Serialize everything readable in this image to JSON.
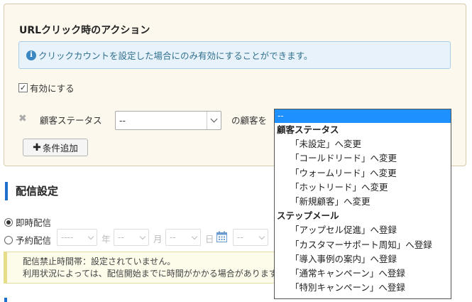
{
  "url_action": {
    "title": "URLクリック時のアクション",
    "info": "クリックカウントを設定した場合にのみ有効にすることができます。",
    "enable_label": "有効にする",
    "enable_checked": true,
    "condition": {
      "remove_symbol": "✖",
      "label": "顧客ステータス",
      "select_value": "--",
      "suffix": "の顧客を"
    },
    "add_button_label": "条件追加"
  },
  "dropdown": {
    "selected": "--",
    "groups": [
      {
        "label": "顧客ステータス",
        "options": [
          "「未設定」へ変更",
          "「コールドリード」へ変更",
          "「ウォームリード」へ変更",
          "「ホットリード」へ変更",
          "「新規顧客」へ変更"
        ]
      },
      {
        "label": "ステップメール",
        "options": [
          "「アップセル促進」へ登録",
          "「カスタマーサポート周知」へ登録",
          "「導入事例の案内」へ登録",
          "「通常キャンペーン」へ登録",
          "「特別キャンペーン」へ登録"
        ]
      }
    ]
  },
  "delivery": {
    "section_title": "配信設定",
    "immediate_label": "即時配信",
    "scheduled_label": "予約配信",
    "immediate_checked": true,
    "year_value": "----",
    "year_unit": "年",
    "month_value": "--",
    "month_unit": "月",
    "day_value": "--",
    "day_unit": "日",
    "hour_value": "--",
    "warning_line1": "配信禁止時間帯：設定されていません。",
    "warning_line2": "利用状況によっては、配信開始までに時間がかかる場合があります。"
  },
  "colors": {
    "accent": "#1f6fcc",
    "dropdown_highlight": "#1e90ff",
    "panel_bg": "#fcf8ed",
    "info_bg": "#e7f2fa"
  }
}
